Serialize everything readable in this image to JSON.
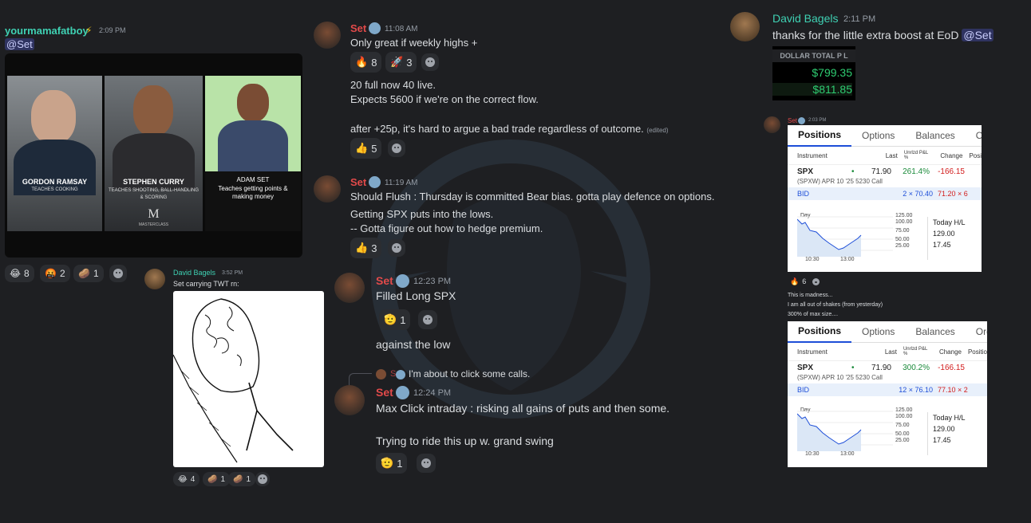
{
  "col1": {
    "msg": {
      "user": "yourmamafatboy",
      "badge": "⚡",
      "time": "2:09 PM",
      "text": "@Set"
    },
    "image": {
      "panels": [
        {
          "name": "GORDON RAMSAY",
          "sub": "TEACHES COOKING"
        },
        {
          "name": "STEPHEN CURRY",
          "sub": "TEACHES SHOOTING, BALL-HANDLING & SCORING",
          "logo": "M",
          "logo_text": "MASTERCLASS"
        },
        {
          "name": "ADAM SET",
          "sub": "Teaches getting points & making money"
        }
      ]
    },
    "reactions": [
      {
        "emoji": "😂",
        "count": "8"
      },
      {
        "emoji": "🤬",
        "count": "2"
      },
      {
        "emoji": "🥔",
        "count": "1"
      }
    ],
    "reply": {
      "user": "David Bagels",
      "time": "3:52 PM",
      "text": "Set carrying TWT rn:"
    },
    "reply_reactions": [
      {
        "emoji": "😂",
        "count": "4"
      },
      {
        "emoji": "🥔",
        "count": "1"
      },
      {
        "emoji": "🥔",
        "count": "1"
      }
    ]
  },
  "col2": {
    "msg1": {
      "user": "Set",
      "time": "11:08 AM",
      "text": "Only great if weekly highs +"
    },
    "msg1_reactions": [
      {
        "emoji": "🔥",
        "count": "8"
      },
      {
        "emoji": "🚀",
        "count": "3"
      }
    ],
    "msg1_line2": "20 full now 40 live.",
    "msg1_line3": "Expects 5600 if we're on the correct flow.",
    "msg1_line4": "after +25p, it's hard to argue a bad trade regardless of outcome.",
    "msg1_edited": "(edited)",
    "msg1_reactions2": [
      {
        "emoji": "👍",
        "count": "5"
      }
    ],
    "msg2": {
      "user": "Set",
      "time": "11:19 AM",
      "text": "Should Flush : Thursday is committed Bear bias. gotta play defence on options."
    },
    "msg2_line2": "Getting SPX puts into the lows.",
    "msg2_line3": "-- Gotta figure out how to hedge premium.",
    "msg2_reactions": [
      {
        "emoji": "👍",
        "count": "3"
      }
    ],
    "msg3": {
      "user": "Set",
      "time": "12:23 PM",
      "text": "Filled Long SPX"
    },
    "msg3_reactions": [
      {
        "emoji": "🫡",
        "count": "1"
      }
    ],
    "msg3_line2": "against the low",
    "reply_ref": {
      "user": "Set",
      "text": "I'm about to click some calls."
    },
    "msg4": {
      "user": "Set",
      "time": "12:24 PM",
      "text": "Max Click intraday : risking all gains of puts and then some."
    },
    "msg4_line2": "Trying to ride this up w. grand swing",
    "msg4_reactions": [
      {
        "emoji": "🫡",
        "count": "1"
      }
    ]
  },
  "col3": {
    "msg": {
      "user": "David Bagels",
      "time": "2:11 PM",
      "text": "thanks for the little extra boost at EoD",
      "mention": "@Set"
    },
    "pnl": {
      "label": "DOLLAR TOTAL P L",
      "v1": "$799.35",
      "v2": "$811.85"
    },
    "set_time": "2:03 PM",
    "set_user": "Set",
    "panels": [
      {
        "tabs": [
          "Positions",
          "Options",
          "Balances",
          "Orde"
        ],
        "headers": [
          "Instrument",
          "Last",
          "Unrlzd P&L %",
          "Change",
          "Posi"
        ],
        "symbol": "SPX",
        "last": "71.90",
        "pnl": "261.4%",
        "change": "-166.15",
        "desc": "(SPXW) APR 10 '25 5230 Call",
        "bid_label": "BID",
        "bid": "2 × 70.40",
        "ask": "71.20 × 6",
        "ylabels": [
          "125.00",
          "100.00",
          "75.00",
          "50.00",
          "25.00"
        ],
        "xlabels": [
          "10:30",
          "13:00"
        ],
        "ylabel_top": "Day",
        "hl_label": "Today H/L",
        "high": "129.00",
        "low": "17.45"
      },
      {
        "tabs": [
          "Positions",
          "Options",
          "Balances",
          "Orders"
        ],
        "headers": [
          "Instrument",
          "Last",
          "Unrlzd P&L %",
          "Change",
          "Positio"
        ],
        "symbol": "SPX",
        "last": "71.90",
        "pnl": "300.2%",
        "change": "-166.15",
        "desc": "(SPXW) APR 10 '25 5230 Call",
        "bid_label": "BID",
        "bid": "12 × 76.10",
        "ask": "77.10 × 2",
        "ylabels": [
          "125.00",
          "100.00",
          "75.00",
          "50.00",
          "25.00"
        ],
        "xlabels": [
          "10:30",
          "13:00"
        ],
        "ylabel_top": "Day",
        "hl_label": "Today H/L",
        "high": "129.00",
        "low": "17.45"
      }
    ],
    "panel_reactions": [
      {
        "emoji": "🔥",
        "count": "6"
      }
    ],
    "lines": [
      "This is madness...",
      "I am all out of shakes (from yesterday)",
      "300% of max size...."
    ]
  }
}
